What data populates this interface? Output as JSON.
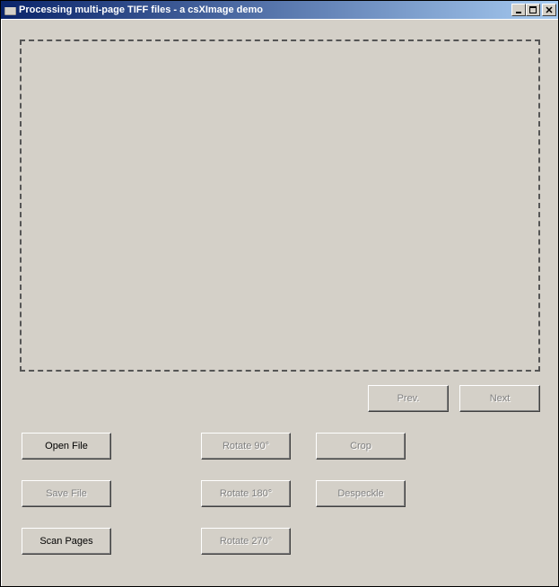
{
  "window": {
    "title": "Processing multi-page TIFF files - a csXImage demo"
  },
  "nav": {
    "prev_label": "Prev.",
    "next_label": "Next"
  },
  "actions": {
    "open_file_label": "Open File",
    "save_file_label": "Save File",
    "scan_pages_label": "Scan Pages",
    "rotate_90_label": "Rotate 90°",
    "rotate_180_label": "Rotate 180°",
    "rotate_270_label": "Rotate 270°",
    "crop_label": "Crop",
    "despeckle_label": "Despeckle"
  }
}
